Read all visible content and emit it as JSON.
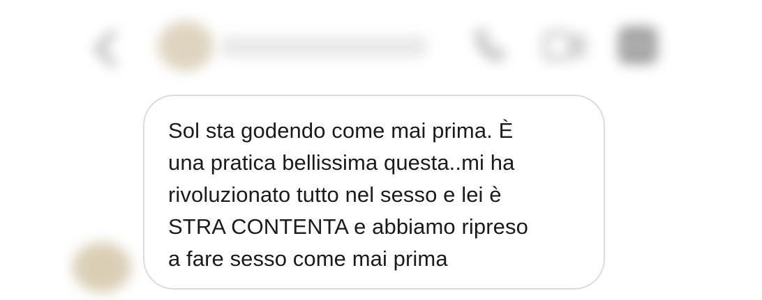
{
  "header": {
    "contact_name": "",
    "icons": [
      "back-chevron-icon",
      "phone-icon",
      "video-call-icon",
      "more-icon"
    ]
  },
  "message": {
    "lines": [
      "Sol sta godendo come mai prima. È",
      "una pratica bellissima questa..mi ha",
      "rivoluzionato tutto nel sesso e lei è",
      "STRA CONTENTA e abbiamo ripreso",
      "a fare sesso come mai prima"
    ]
  },
  "colors": {
    "bubble_border": "#dcdcdc",
    "text": "#1b1b1b",
    "background": "#ffffff"
  }
}
